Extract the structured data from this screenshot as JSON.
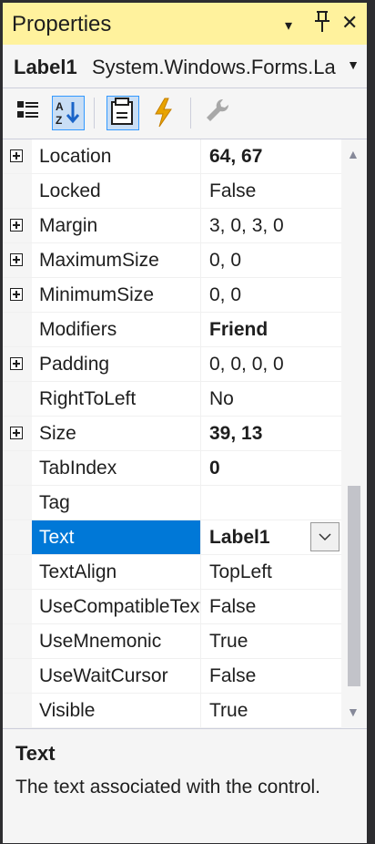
{
  "window": {
    "title": "Properties"
  },
  "titlebar": {
    "menu_glyph": "▾",
    "pin_glyph": "ᛨ",
    "close_glyph": "✕"
  },
  "object_selector": {
    "name": "Label1",
    "type": "System.Windows.Forms.La"
  },
  "toolbar": {
    "buttons": [
      {
        "name": "categorized-icon",
        "active": false
      },
      {
        "name": "alphabetical-icon",
        "active": true
      },
      {
        "name": "properties-icon",
        "active": true
      },
      {
        "name": "events-icon",
        "active": false
      },
      {
        "name": "property-pages-icon",
        "active": false
      }
    ]
  },
  "properties": [
    {
      "name": "Location",
      "value": "64, 67",
      "expandable": true,
      "bold": true
    },
    {
      "name": "Locked",
      "value": "False",
      "expandable": false,
      "bold": false
    },
    {
      "name": "Margin",
      "value": "3, 0, 3, 0",
      "expandable": true,
      "bold": false
    },
    {
      "name": "MaximumSize",
      "value": "0, 0",
      "expandable": true,
      "bold": false
    },
    {
      "name": "MinimumSize",
      "value": "0, 0",
      "expandable": true,
      "bold": false
    },
    {
      "name": "Modifiers",
      "value": "Friend",
      "expandable": false,
      "bold": true
    },
    {
      "name": "Padding",
      "value": "0, 0, 0, 0",
      "expandable": true,
      "bold": false
    },
    {
      "name": "RightToLeft",
      "value": "No",
      "expandable": false,
      "bold": false
    },
    {
      "name": "Size",
      "value": "39, 13",
      "expandable": true,
      "bold": true
    },
    {
      "name": "TabIndex",
      "value": "0",
      "expandable": false,
      "bold": true
    },
    {
      "name": "Tag",
      "value": "",
      "expandable": false,
      "bold": false
    },
    {
      "name": "Text",
      "value": "Label1",
      "expandable": false,
      "bold": true,
      "selected": true
    },
    {
      "name": "TextAlign",
      "value": "TopLeft",
      "expandable": false,
      "bold": false
    },
    {
      "name": "UseCompatibleTextRendering",
      "value": "False",
      "expandable": false,
      "bold": false
    },
    {
      "name": "UseMnemonic",
      "value": "True",
      "expandable": false,
      "bold": false
    },
    {
      "name": "UseWaitCursor",
      "value": "False",
      "expandable": false,
      "bold": false
    },
    {
      "name": "Visible",
      "value": "True",
      "expandable": false,
      "bold": false
    }
  ],
  "description": {
    "title": "Text",
    "text": "The text associated with the control."
  },
  "colors": {
    "titlebar_bg": "#fff29d",
    "selection": "#0078d7",
    "panel_bg": "#f5f5f5"
  }
}
